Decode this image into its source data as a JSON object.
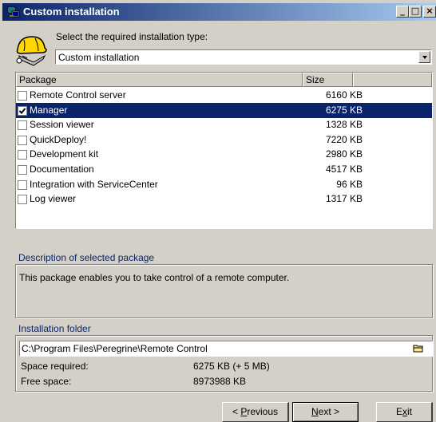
{
  "window": {
    "title": "Custom installation",
    "controls": {
      "minimize": "_",
      "maximize": "□",
      "close": "×"
    }
  },
  "header": {
    "prompt": "Select the required installation type:",
    "install_type": "Custom installation"
  },
  "packages": {
    "columns": [
      "Package",
      "Size"
    ],
    "rows": [
      {
        "name": "Remote Control server",
        "size": "6160 KB",
        "checked": false,
        "selected": false
      },
      {
        "name": "Manager",
        "size": "6275 KB",
        "checked": true,
        "selected": true
      },
      {
        "name": "Session viewer",
        "size": "1328 KB",
        "checked": false,
        "selected": false
      },
      {
        "name": "QuickDeploy!",
        "size": "7220 KB",
        "checked": false,
        "selected": false
      },
      {
        "name": "Development kit",
        "size": "2980 KB",
        "checked": false,
        "selected": false
      },
      {
        "name": "Documentation",
        "size": "4517 KB",
        "checked": false,
        "selected": false
      },
      {
        "name": "Integration with ServiceCenter",
        "size": "96 KB",
        "checked": false,
        "selected": false
      },
      {
        "name": "Log viewer",
        "size": "1317 KB",
        "checked": false,
        "selected": false
      }
    ]
  },
  "description": {
    "label": "Description of selected package",
    "text": "This package enables you to take control of a remote computer."
  },
  "folder": {
    "label": "Installation folder",
    "path": "C:\\Program Files\\Peregrine\\Remote Control",
    "space_required_label": "Space required:",
    "space_required_value": "6275 KB (+ 5 MB)",
    "free_space_label": "Free space:",
    "free_space_value": "8973988 KB"
  },
  "buttons": {
    "previous": {
      "pre": "< ",
      "mnemonic": "P",
      "post": "revious"
    },
    "next": {
      "mnemonic": "N",
      "post": "ext >"
    },
    "exit": {
      "pre": "E",
      "mnemonic": "x",
      "post": "it"
    }
  },
  "colors": {
    "titlebar_start": "#0a246a",
    "titlebar_end": "#a6caf0",
    "selection": "#0a246a",
    "group_label": "#0a246a",
    "face": "#d4d0c8"
  }
}
